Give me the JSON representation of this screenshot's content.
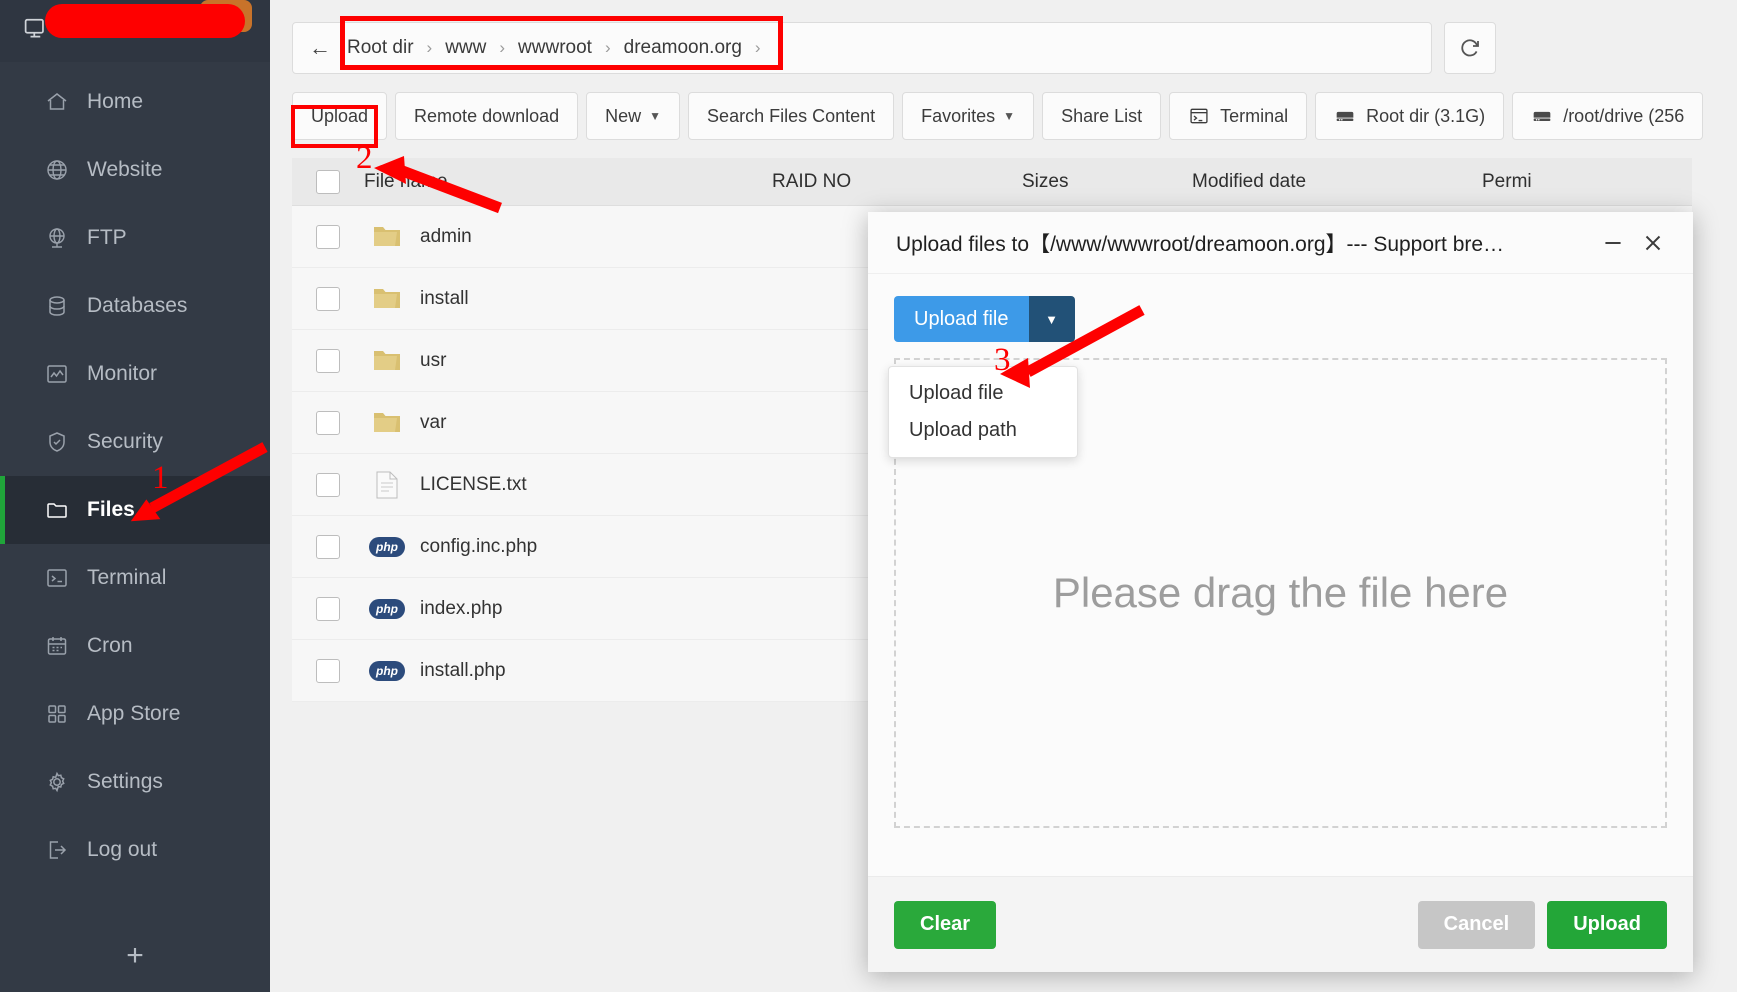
{
  "sidebar": {
    "header": {
      "icon": "monitor-icon",
      "redacted": true
    },
    "items": [
      {
        "label": "Home",
        "icon": "home-icon",
        "active": false
      },
      {
        "label": "Website",
        "icon": "globe-icon",
        "active": false
      },
      {
        "label": "FTP",
        "icon": "ftp-icon",
        "active": false
      },
      {
        "label": "Databases",
        "icon": "database-icon",
        "active": false
      },
      {
        "label": "Monitor",
        "icon": "monitor-chart-icon",
        "active": false
      },
      {
        "label": "Security",
        "icon": "shield-icon",
        "active": false
      },
      {
        "label": "Files",
        "icon": "folder-icon",
        "active": true
      },
      {
        "label": "Terminal",
        "icon": "terminal-icon",
        "active": false
      },
      {
        "label": "Cron",
        "icon": "calendar-icon",
        "active": false
      },
      {
        "label": "App Store",
        "icon": "grid-icon",
        "active": false
      },
      {
        "label": "Settings",
        "icon": "gear-icon",
        "active": false
      },
      {
        "label": "Log out",
        "icon": "logout-icon",
        "active": false
      }
    ],
    "add_label": "+",
    "active_accent": "#20a53a"
  },
  "breadcrumb": {
    "back_icon": "arrow-left-icon",
    "items": [
      "Root dir",
      "www",
      "wwwroot",
      "dreamoon.org"
    ],
    "separator": "›",
    "trailing_separator": "›",
    "refresh_icon": "refresh-icon"
  },
  "toolbar": {
    "buttons": [
      {
        "label": "Upload",
        "icon": null,
        "caret": false
      },
      {
        "label": "Remote download",
        "icon": null,
        "caret": false
      },
      {
        "label": "New",
        "icon": null,
        "caret": true
      },
      {
        "label": "Search Files Content",
        "icon": null,
        "caret": false
      },
      {
        "label": "Favorites",
        "icon": null,
        "caret": true
      },
      {
        "label": "Share List",
        "icon": null,
        "caret": false
      },
      {
        "label": "Terminal",
        "icon": "terminal-icon",
        "caret": false
      },
      {
        "label": "Root dir (3.1G)",
        "icon": "disk-icon",
        "caret": false
      },
      {
        "label": "/root/drive (256",
        "icon": "disk-icon",
        "caret": false
      }
    ]
  },
  "file_table": {
    "headers": [
      "File name",
      "RAID NO",
      "Sizes",
      "Modified date",
      "Permi"
    ],
    "rows": [
      {
        "name": "admin",
        "icon": "folder-icon",
        "checked": false
      },
      {
        "name": "install",
        "icon": "folder-icon",
        "checked": false
      },
      {
        "name": "usr",
        "icon": "folder-icon",
        "checked": false
      },
      {
        "name": "var",
        "icon": "folder-icon",
        "checked": false
      },
      {
        "name": "LICENSE.txt",
        "icon": "text-file-icon",
        "checked": false
      },
      {
        "name": "config.inc.php",
        "icon": "php-icon",
        "checked": false
      },
      {
        "name": "index.php",
        "icon": "php-icon",
        "checked": false
      },
      {
        "name": "install.php",
        "icon": "php-icon",
        "checked": false
      }
    ]
  },
  "dialog": {
    "title": "Upload files to【/www/wwwroot/dreamoon.org】--- Support bre…",
    "minimize_icon": "minimize-icon",
    "close_icon": "close-icon",
    "upload_button": "Upload file",
    "dropdown_caret_icon": "chevron-down-icon",
    "menu": [
      "Upload file",
      "Upload path"
    ],
    "dropzone_text": "Please drag the file here",
    "footer": {
      "clear": "Clear",
      "cancel": "Cancel",
      "upload": "Upload"
    },
    "accent_blue": "#3d9ae8",
    "accent_green": "#2aa93b"
  },
  "annotations": {
    "color": "#fe0000",
    "marks": [
      {
        "number": "1",
        "target": "sidebar-item-files"
      },
      {
        "number": "2",
        "target": "toolbar-upload-button"
      },
      {
        "number": "3",
        "target": "dialog-upload-file-menu-item"
      }
    ]
  }
}
